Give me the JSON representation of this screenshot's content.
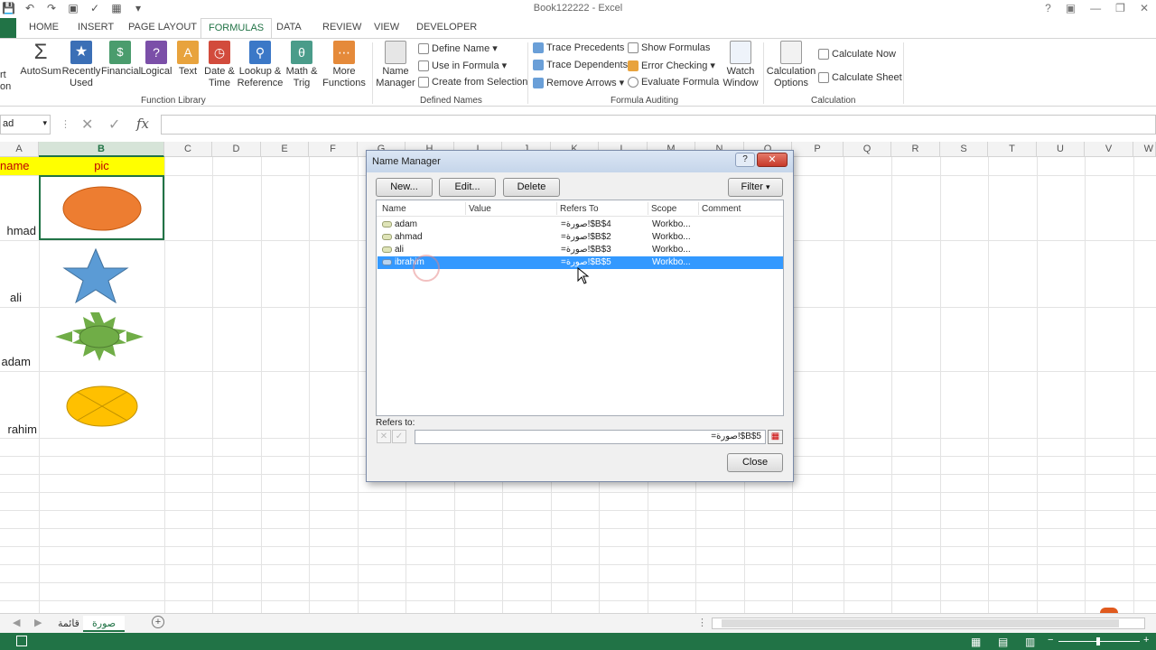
{
  "window": {
    "title": "Book122222 - Excel"
  },
  "tabs": [
    "HOME",
    "INSERT",
    "PAGE LAYOUT",
    "FORMULAS",
    "DATA",
    "REVIEW",
    "VIEW",
    "DEVELOPER"
  ],
  "active_tab": "FORMULAS",
  "ribbon": {
    "function_library": {
      "label": "Function Library",
      "left_partial": [
        "rt",
        "on"
      ],
      "autosum": "AutoSum",
      "recently": [
        "Recently",
        "Used"
      ],
      "financial": "Financial",
      "logical": "Logical",
      "text": "Text",
      "datetime": [
        "Date &",
        "Time"
      ],
      "lookup": [
        "Lookup &",
        "Reference"
      ],
      "math": [
        "Math &",
        "Trig"
      ],
      "more": [
        "More",
        "Functions"
      ]
    },
    "defined_names": {
      "label": "Defined Names",
      "name_manager": [
        "Name",
        "Manager"
      ],
      "define_name": "Define Name",
      "use_in_formula": "Use in Formula",
      "create_from_selection": "Create from Selection"
    },
    "formula_auditing": {
      "label": "Formula Auditing",
      "trace_precedents": "Trace Precedents",
      "trace_dependents": "Trace Dependents",
      "remove_arrows": "Remove Arrows",
      "show_formulas": "Show Formulas",
      "error_checking": "Error Checking",
      "evaluate_formula": "Evaluate Formula",
      "watch_window": [
        "Watch",
        "Window"
      ]
    },
    "calculation": {
      "label": "Calculation",
      "options": [
        "Calculation",
        "Options"
      ],
      "calc_now": "Calculate Now",
      "calc_sheet": "Calculate Sheet"
    }
  },
  "formula_bar": {
    "name_box": "ad",
    "fx": "fx"
  },
  "columns": [
    "A",
    "B",
    "C",
    "D",
    "E",
    "F",
    "G",
    "H",
    "I",
    "J",
    "K",
    "L",
    "M",
    "N",
    "O",
    "P",
    "Q",
    "R",
    "S",
    "T",
    "U",
    "V",
    "W"
  ],
  "cells": {
    "a1": "name",
    "b1": "pic",
    "a2": "hmad",
    "a3": "ali",
    "a4": "adam",
    "a5": "rahim"
  },
  "sheet_tabs": [
    "قائمة",
    "صورة"
  ],
  "active_sheet": "صورة",
  "dialog": {
    "title": "Name Manager",
    "help": "?",
    "new": "New...",
    "edit": "Edit...",
    "delete": "Delete",
    "filter": "Filter",
    "headers": [
      "Name",
      "Value",
      "Refers To",
      "Scope",
      "Comment"
    ],
    "rows": [
      {
        "name": "adam",
        "value": "",
        "refers": "=صورة!$B$4",
        "scope": "Workbo..."
      },
      {
        "name": "ahmad",
        "value": "",
        "refers": "=صورة!$B$2",
        "scope": "Workbo..."
      },
      {
        "name": "ali",
        "value": "",
        "refers": "=صورة!$B$3",
        "scope": "Workbo..."
      },
      {
        "name": "ibrahim",
        "value": "",
        "refers": "=صورة!$B$5",
        "scope": "Workbo..."
      }
    ],
    "refers_to_label": "Refers to:",
    "refers_to_value": "=صورة!$B$5",
    "close": "Close"
  },
  "colors": {
    "excel_green": "#217346",
    "header_fill": "#ffff00",
    "header_text": "#c00000",
    "selection": "#3399ff"
  }
}
